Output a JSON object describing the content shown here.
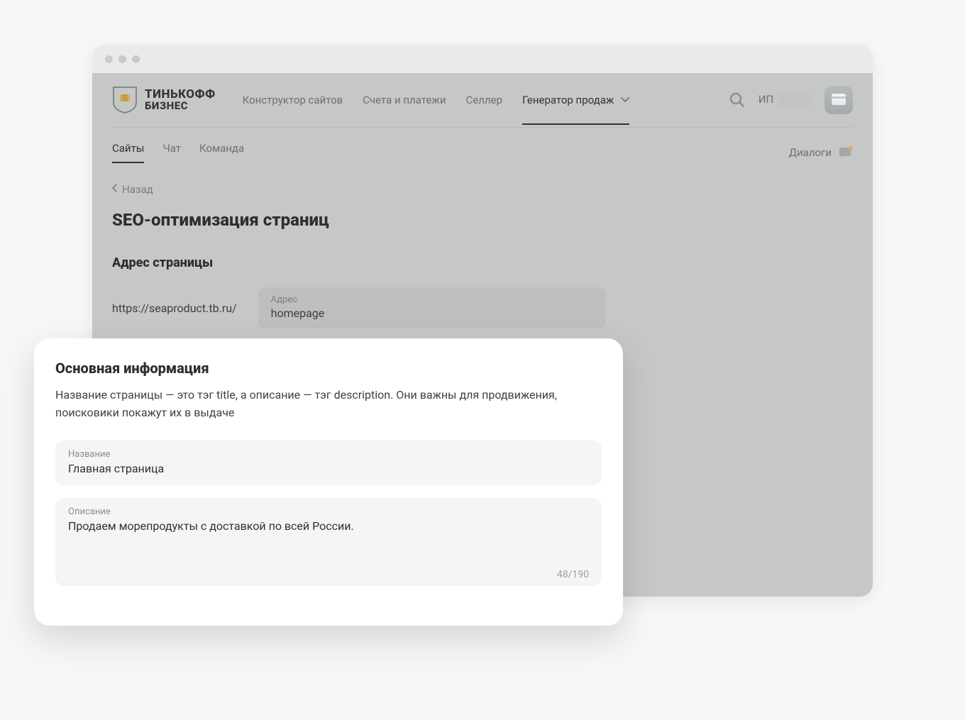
{
  "brand": {
    "line1": "ТИНЬКОФФ",
    "line2": "БИЗНЕС"
  },
  "top_nav": {
    "items": [
      {
        "label": "Конструктор сайтов",
        "active": false
      },
      {
        "label": "Счета и платежи",
        "active": false
      },
      {
        "label": "Селлер",
        "active": false
      },
      {
        "label": "Генератор продаж",
        "active": true,
        "has_dropdown": true
      }
    ]
  },
  "user": {
    "prefix": "ИП"
  },
  "sub_nav": {
    "items": [
      {
        "label": "Сайты",
        "active": true
      },
      {
        "label": "Чат",
        "active": false
      },
      {
        "label": "Команда",
        "active": false
      }
    ],
    "right_label": "Диалоги"
  },
  "back_label": "Назад",
  "page_title": "SEO-оптимизация страниц",
  "address": {
    "section_title": "Адрес страницы",
    "prefix": "https://seaproduct.tb.ru/",
    "field_label": "Адрес",
    "field_value": "homepage"
  },
  "overlay": {
    "title": "Основная информация",
    "description": "Название страницы — это тэг title, а описание — тэг description. Они важны для продвижения, поисковики покажут их в выдаче",
    "name_label": "Название",
    "name_value": "Главная страница",
    "desc_label": "Описание",
    "desc_value": "Продаем морепродукты с доставкой по всей России.",
    "char_count": "48/190"
  }
}
